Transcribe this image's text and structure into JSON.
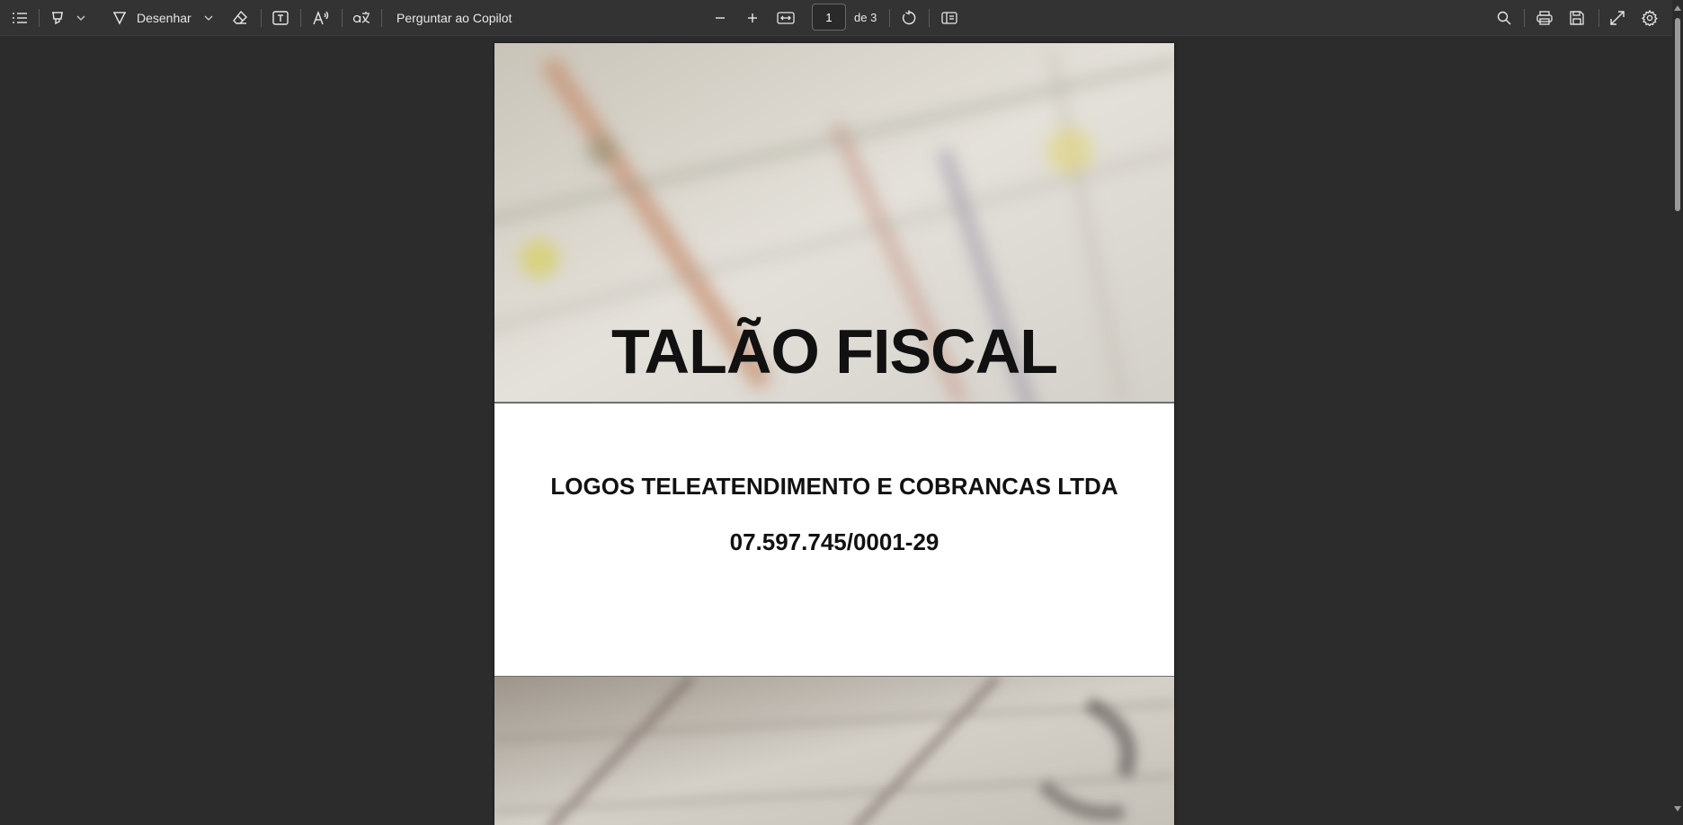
{
  "toolbar": {
    "draw_label": "Desenhar",
    "copilot_label": "Perguntar ao Copilot",
    "page_number": "1",
    "page_of": "de 3"
  },
  "document": {
    "title": "TALÃO FISCAL",
    "company": "LOGOS TELEATENDIMENTO E COBRANCAS LTDA",
    "cnpj": "07.597.745/0001-29"
  },
  "colors": {
    "toolbar_bg": "#333333",
    "viewer_bg": "#2c2c2c",
    "page_bg": "#ffffff"
  },
  "icons": [
    "contents-icon",
    "highlight-icon",
    "chevron-down-icon",
    "draw-icon",
    "eraser-icon",
    "text-box-icon",
    "read-aloud-icon",
    "translate-icon",
    "zoom-out-icon",
    "zoom-in-icon",
    "fit-width-icon",
    "rotate-icon",
    "page-view-icon",
    "search-icon",
    "print-icon",
    "save-icon",
    "fullscreen-icon",
    "settings-icon"
  ]
}
